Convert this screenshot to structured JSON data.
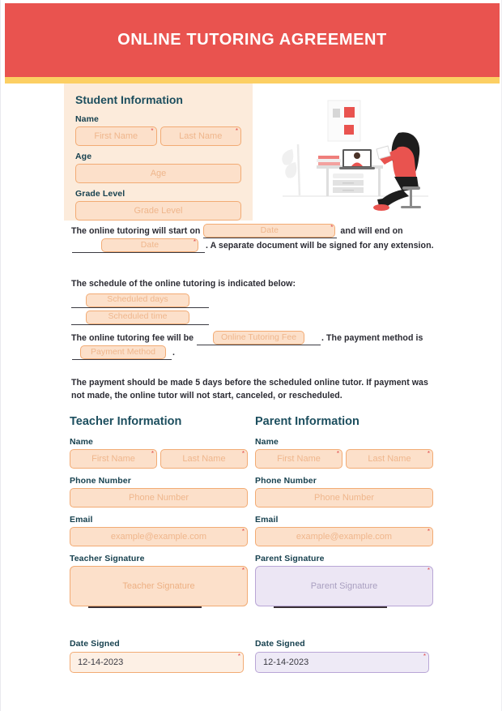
{
  "document": {
    "title": "ONLINE TUTORING AGREEMENT"
  },
  "colors": {
    "header_red": "#E9534F",
    "accent_yellow": "#FCCF63",
    "panel_cream": "#FCEBDB",
    "field_peach": "#FCE0CA",
    "field_border": "#F2AB74",
    "heading_teal": "#1C4E5E",
    "signature_lilac": "#ECE6F4",
    "lilac_border": "#B9A6D6",
    "required_star": "#E0484A"
  },
  "student_section": {
    "title": "Student Information",
    "name_label": "Name",
    "first_name_placeholder": "First Name",
    "last_name_placeholder": "Last Name",
    "age_label": "Age",
    "age_placeholder": "Age",
    "grade_label": "Grade Level",
    "grade_placeholder": "Grade Level"
  },
  "illustration": {
    "name": "online-tutoring-illustration",
    "description": "Person seated at a desk with a laptop showing a student on a video call, books, drawers and a plant"
  },
  "clauses": {
    "start_text_1": "The online tutoring will start on",
    "start_date_placeholder": "Date",
    "start_text_2": "and will end on",
    "end_date_placeholder": "Date",
    "start_text_3": ". A separate document will be signed for any extension.",
    "schedule_intro": "The schedule of the online tutoring is indicated below:",
    "scheduled_days_placeholder": "Scheduled days",
    "scheduled_time_placeholder": "Scheduled time",
    "fee_text_1": "The online tutoring fee will be",
    "fee_placeholder": "Online Tutoring Fee",
    "fee_text_2": ". The payment method is",
    "payment_method_placeholder": "Payment Method",
    "fee_text_3": ".",
    "payment_terms": "The payment should be made 5 days before the scheduled online tutor. If payment was not made, the online tutor will not start, canceled, or rescheduled."
  },
  "teacher_section": {
    "title": "Teacher Information",
    "name_label": "Name",
    "first_name_placeholder": "First Name",
    "last_name_placeholder": "Last Name",
    "phone_label": "Phone Number",
    "phone_placeholder": "Phone Number",
    "email_label": "Email",
    "email_placeholder": "example@example.com",
    "signature_label": "Teacher Signature",
    "signature_placeholder": "Teacher Signature",
    "date_signed_label": "Date Signed",
    "date_signed_value": "12-14-2023"
  },
  "parent_section": {
    "title": "Parent Information",
    "name_label": "Name",
    "first_name_placeholder": "First Name",
    "last_name_placeholder": "Last Name",
    "phone_label": "Phone Number",
    "phone_placeholder": "Phone Number",
    "email_label": "Email",
    "email_placeholder": "example@example.com",
    "signature_label": "Parent Signature",
    "signature_placeholder": "Parent Signature",
    "date_signed_label": "Date Signed",
    "date_signed_value": "12-14-2023"
  },
  "required_marker": "*"
}
